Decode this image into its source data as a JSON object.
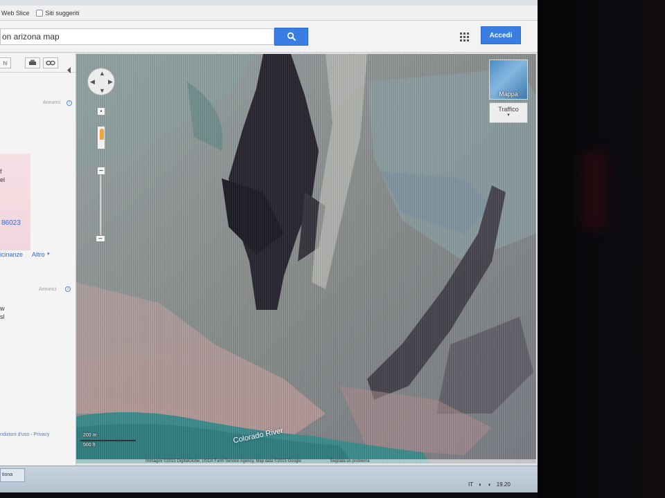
{
  "bookmarks": [
    {
      "label": "Web Slice"
    },
    {
      "label": "Siti suggeriti"
    }
  ],
  "search": {
    "value": "on arizona map",
    "button_icon": "search-icon"
  },
  "header": {
    "apps_icon": "apps-grid-icon",
    "signin_label": "Accedi"
  },
  "sidebar": {
    "ads_label_1": "Annunci",
    "ads_label_2": "Annunci",
    "text_f": "f",
    "text_el": "el",
    "phone_fragment": "86023",
    "links": {
      "nearby": "icinanze",
      "more": "Altro"
    },
    "text_w": "w",
    "text_sl": "sl",
    "footer": "ndizioni d'uso - Privacy"
  },
  "map": {
    "type_label": "Mappa",
    "traffic_label": "Traffico",
    "river_label": "Colorado River",
    "scale": {
      "metric": "200 m",
      "imperial": "500 ft"
    },
    "attribution": "Immagini ©2015 DigitalGlobe, USDA Farm Service Agency, Map data ©2015 Google",
    "report_link": "Segnala un problema"
  },
  "taskbar": {
    "item_label": "tiona",
    "tray_lang": "IT",
    "clock": "19.20"
  }
}
